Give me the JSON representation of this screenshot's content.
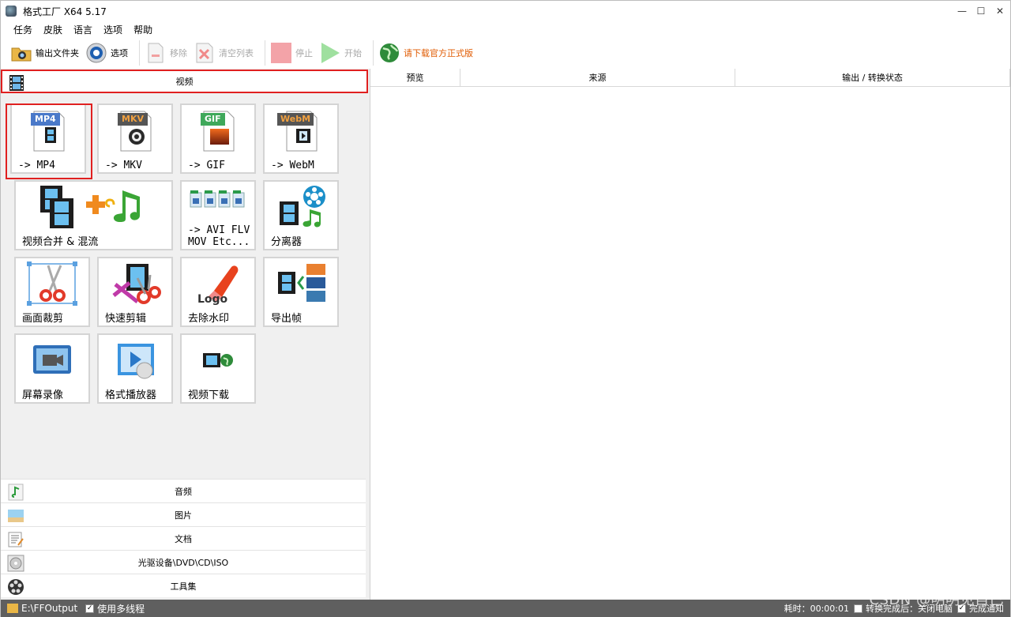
{
  "window": {
    "title": "格式工厂 X64 5.17",
    "minimize": "—",
    "maximize": "☐",
    "close": "✕"
  },
  "menu": [
    "任务",
    "皮肤",
    "语言",
    "选项",
    "帮助"
  ],
  "toolbar": {
    "output_folder": "输出文件夹",
    "options": "选项",
    "remove": "移除",
    "clear_list": "清空列表",
    "stop": "停止",
    "start": "开始",
    "download_official": "请下载官方正式版"
  },
  "left": {
    "video_header": "视频",
    "tiles": [
      {
        "id": "mp4",
        "badge": "MP4",
        "label": "-> MP4",
        "badge_color": "#4a79c9"
      },
      {
        "id": "mkv",
        "badge": "MKV",
        "label": "-> MKV",
        "badge_color": "#555555"
      },
      {
        "id": "gif",
        "badge": "GIF",
        "label": "-> GIF",
        "badge_color": "#3fa85a"
      },
      {
        "id": "webm",
        "badge": "WebM",
        "label": "-> WebM",
        "badge_color": "#555555"
      },
      {
        "id": "merge",
        "label": "视频合并 & 混流"
      },
      {
        "id": "avi",
        "label": "-> AVI FLV\nMOV Etc..."
      },
      {
        "id": "splitter",
        "label": "分离器"
      },
      {
        "id": "crop",
        "label": "画面裁剪"
      },
      {
        "id": "quickcut",
        "label": "快速剪辑"
      },
      {
        "id": "delogo",
        "label": "去除水印",
        "logo_text": "Logo"
      },
      {
        "id": "frames",
        "label": "导出帧"
      },
      {
        "id": "record",
        "label": "屏幕录像"
      },
      {
        "id": "player",
        "label": "格式播放器"
      },
      {
        "id": "download",
        "label": "视频下载"
      }
    ],
    "categories": [
      "音频",
      "图片",
      "文档",
      "光驱设备\\DVD\\CD\\ISO",
      "工具集"
    ]
  },
  "right": {
    "columns": [
      "预览",
      "来源",
      "输出 / 转换状态"
    ]
  },
  "status": {
    "output_path": "E:\\FFOutput",
    "multithread": "使用多线程",
    "elapsed": "耗时：00:00:01",
    "after_done": "转换完成后：关闭电脑",
    "notify": "完成通知"
  },
  "watermark": "CSDN @明明见自己",
  "colors": {
    "selection_red": "#e02020",
    "statusbar": "#5f5f5f",
    "download_orange": "#e05a00"
  }
}
